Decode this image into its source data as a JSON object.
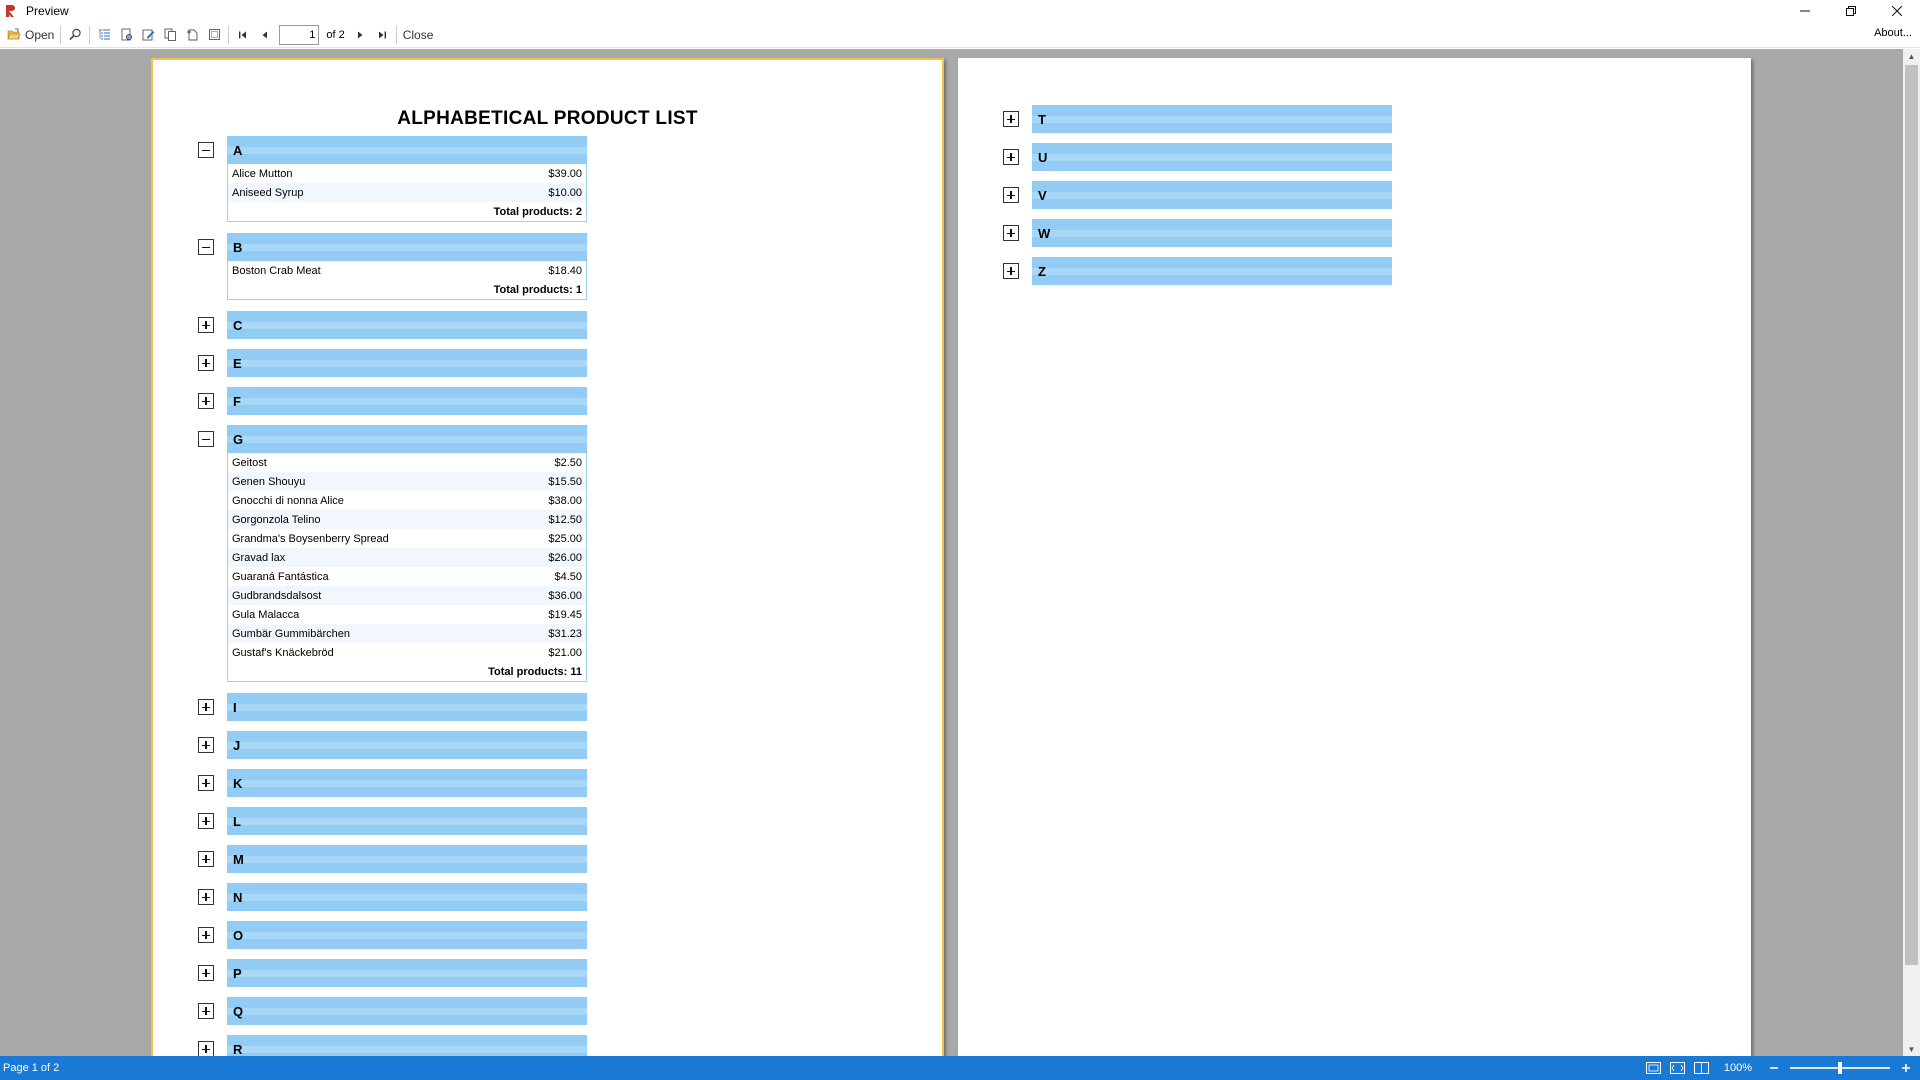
{
  "window": {
    "title": "Preview"
  },
  "toolbar": {
    "open_label": "Open",
    "page_value": "1",
    "of_label": "of 2",
    "close_label": "Close",
    "about_label": "About..."
  },
  "report": {
    "title": "ALPHABETICAL PRODUCT LIST",
    "page1_groups": [
      {
        "letter": "A",
        "expanded": true,
        "items": [
          {
            "name": "Alice Mutton",
            "price": "$39.00"
          },
          {
            "name": "Aniseed Syrup",
            "price": "$10.00"
          }
        ],
        "total": "Total products: 2"
      },
      {
        "letter": "B",
        "expanded": true,
        "items": [
          {
            "name": "Boston Crab Meat",
            "price": "$18.40"
          }
        ],
        "total": "Total products: 1"
      },
      {
        "letter": "C",
        "expanded": false
      },
      {
        "letter": "E",
        "expanded": false
      },
      {
        "letter": "F",
        "expanded": false
      },
      {
        "letter": "G",
        "expanded": true,
        "items": [
          {
            "name": "Geitost",
            "price": "$2.50"
          },
          {
            "name": "Genen Shouyu",
            "price": "$15.50"
          },
          {
            "name": "Gnocchi di nonna Alice",
            "price": "$38.00"
          },
          {
            "name": "Gorgonzola Telino",
            "price": "$12.50"
          },
          {
            "name": "Grandma's Boysenberry Spread",
            "price": "$25.00"
          },
          {
            "name": "Gravad lax",
            "price": "$26.00"
          },
          {
            "name": "Guaraná Fantástica",
            "price": "$4.50"
          },
          {
            "name": "Gudbrandsdalsost",
            "price": "$36.00"
          },
          {
            "name": "Gula Malacca",
            "price": "$19.45"
          },
          {
            "name": "Gumbär Gummibärchen",
            "price": "$31.23"
          },
          {
            "name": "Gustaf's Knäckebröd",
            "price": "$21.00"
          }
        ],
        "total": "Total products: 11"
      },
      {
        "letter": "I",
        "expanded": false
      },
      {
        "letter": "J",
        "expanded": false
      },
      {
        "letter": "K",
        "expanded": false
      },
      {
        "letter": "L",
        "expanded": false
      },
      {
        "letter": "M",
        "expanded": false
      },
      {
        "letter": "N",
        "expanded": false
      },
      {
        "letter": "O",
        "expanded": false
      },
      {
        "letter": "P",
        "expanded": false
      },
      {
        "letter": "Q",
        "expanded": false
      },
      {
        "letter": "R",
        "expanded": false
      }
    ],
    "page2_groups": [
      {
        "letter": "T",
        "expanded": false
      },
      {
        "letter": "U",
        "expanded": false
      },
      {
        "letter": "V",
        "expanded": false
      },
      {
        "letter": "W",
        "expanded": false
      },
      {
        "letter": "Z",
        "expanded": false
      }
    ]
  },
  "statusbar": {
    "page_info": "Page 1 of 2",
    "zoom": "100%",
    "zoom_level": 0.5
  },
  "colors": {
    "accent": "#1b79d6",
    "group_header": "#92ccf4",
    "current_page_border": "#f3c24a"
  }
}
